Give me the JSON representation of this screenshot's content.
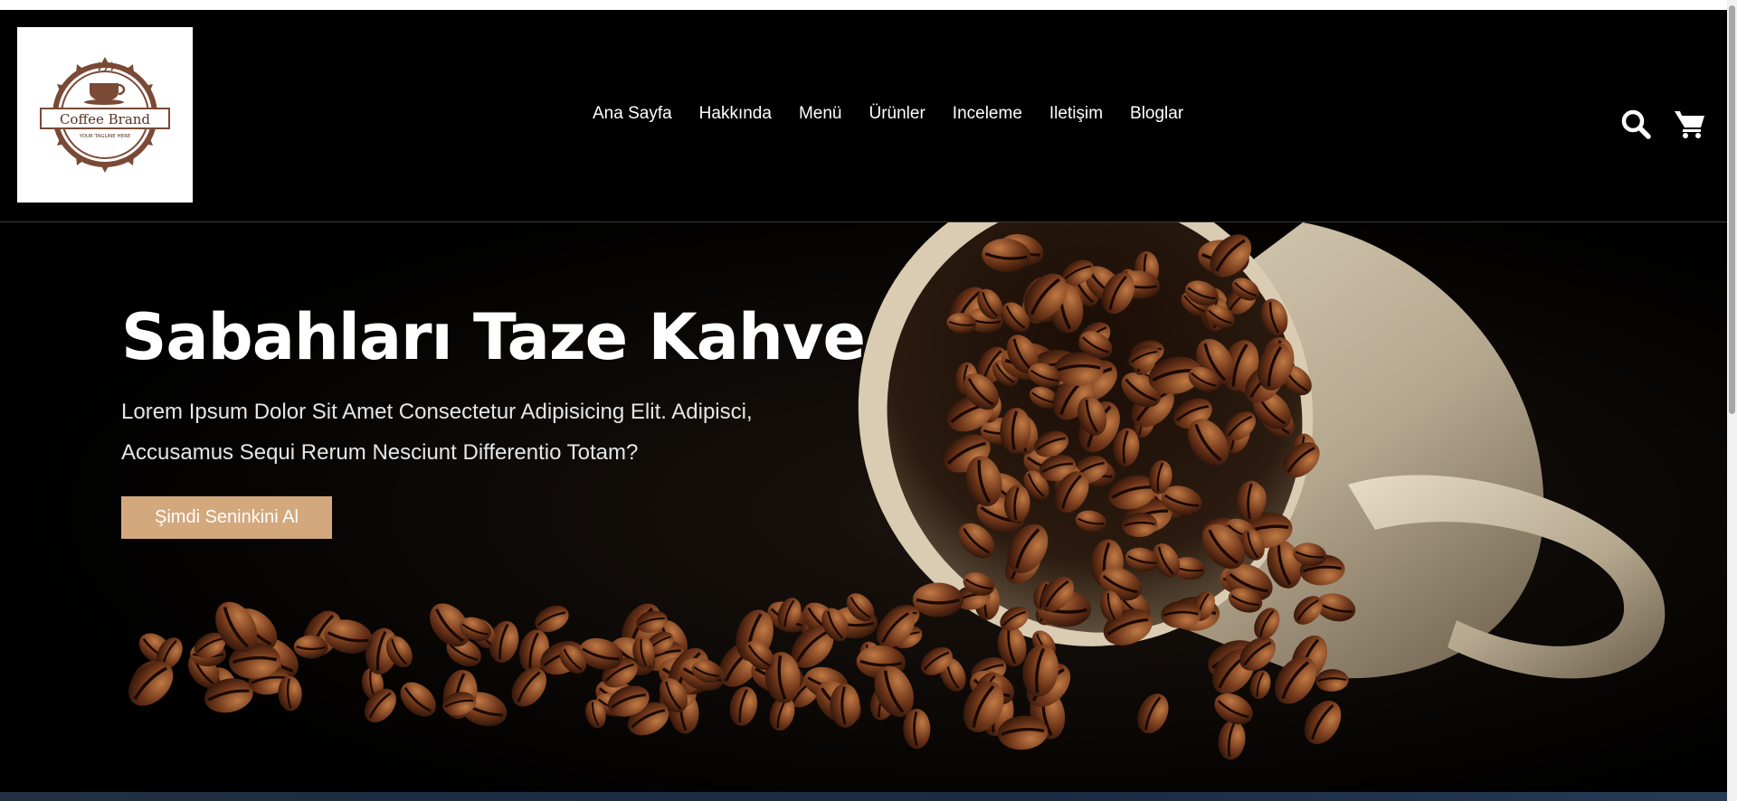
{
  "logo": {
    "brand": "Coffee Brand",
    "tagline": "YOUR TAGLINE HERE"
  },
  "nav": {
    "items": [
      {
        "label": "Ana Sayfa"
      },
      {
        "label": "Hakkında"
      },
      {
        "label": "Menü"
      },
      {
        "label": "Ürünler"
      },
      {
        "label": "Inceleme"
      },
      {
        "label": "Iletişim"
      },
      {
        "label": "Bloglar"
      }
    ]
  },
  "header_icons": [
    "search-icon",
    "cart-icon"
  ],
  "hero": {
    "title": "Sabahları Taze Kahve",
    "description": "Lorem Ipsum Dolor Sit Amet Consectetur Adipisicing Elit. Adipisci, Accusamus Sequi Rerum Nesciunt Differentio Totam?",
    "button_label": "Şimdi Seninkini Al"
  },
  "colors": {
    "background": "#000000",
    "accent": "#d3a87d",
    "logo_brown": "#7a4a36"
  }
}
